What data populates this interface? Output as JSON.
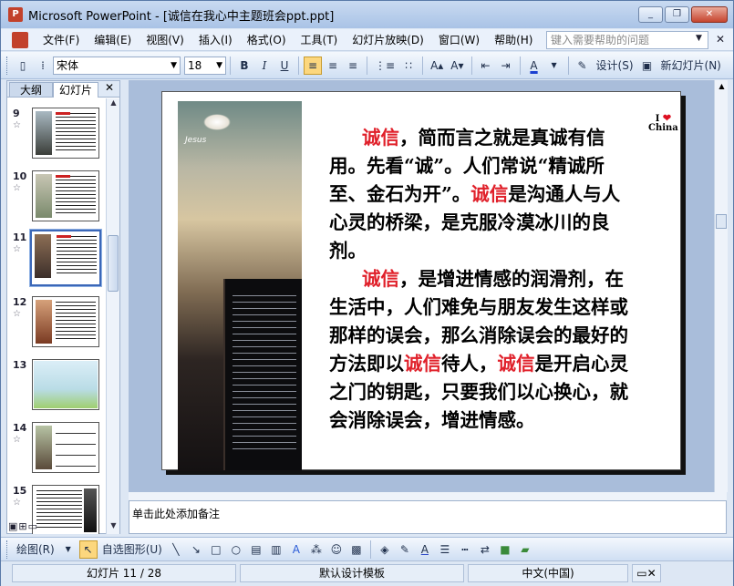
{
  "window": {
    "title": "Microsoft PowerPoint - [诚信在我心中主题班会ppt.ppt]",
    "minimize": "_",
    "restore": "❐",
    "close": "✕"
  },
  "menu": {
    "items": [
      "文件(F)",
      "编辑(E)",
      "视图(V)",
      "插入(I)",
      "格式(O)",
      "工具(T)",
      "幻灯片放映(D)",
      "窗口(W)",
      "帮助(H)"
    ],
    "help_placeholder": "键入需要帮助的问题"
  },
  "toolbar": {
    "font_name": "宋体",
    "font_size": "18",
    "bold": "B",
    "italic": "I",
    "underline": "U",
    "design_label": "设计(S)",
    "new_slide_label": "新幻灯片(N)"
  },
  "left_pane": {
    "tab_outline": "大纲",
    "tab_slides": "幻灯片",
    "close": "✕",
    "slides": [
      {
        "num": "9"
      },
      {
        "num": "10"
      },
      {
        "num": "11"
      },
      {
        "num": "12"
      },
      {
        "num": "13"
      },
      {
        "num": "14"
      },
      {
        "num": "15"
      }
    ]
  },
  "slide": {
    "photo_sign": "Jesus",
    "logo_i": "I",
    "logo_china": "China",
    "p1_red1": "诚信",
    "p1_text1": "，简而言之就是真诚有信用。先看“诚”。人们常说“精诚所至、金石为开”。",
    "p1_red2": "诚信",
    "p1_text2": "是沟通人与人心灵的桥梁，是克服冷漠冰川的良剂。",
    "p2_red1": "诚信",
    "p2_text1": "，是增进情感的润滑剂，在生活中，人们难免与朋友发生这样或那样的误会，那么消除误会的最好的方法即以",
    "p2_red2": "诚信",
    "p2_text2": "待人，",
    "p2_red3": "诚信",
    "p2_text3": "是开启心灵之门的钥匙，只要我们以心换心，就会消除误会，增进情感。"
  },
  "notes": {
    "placeholder": "单击此处添加备注"
  },
  "drawbar": {
    "draw_label": "绘图(R)",
    "autoshape_label": "自选图形(U)"
  },
  "status": {
    "slide_pos": "幻灯片 11 / 28",
    "template": "默认设计模板",
    "language": "中文(中国)"
  }
}
